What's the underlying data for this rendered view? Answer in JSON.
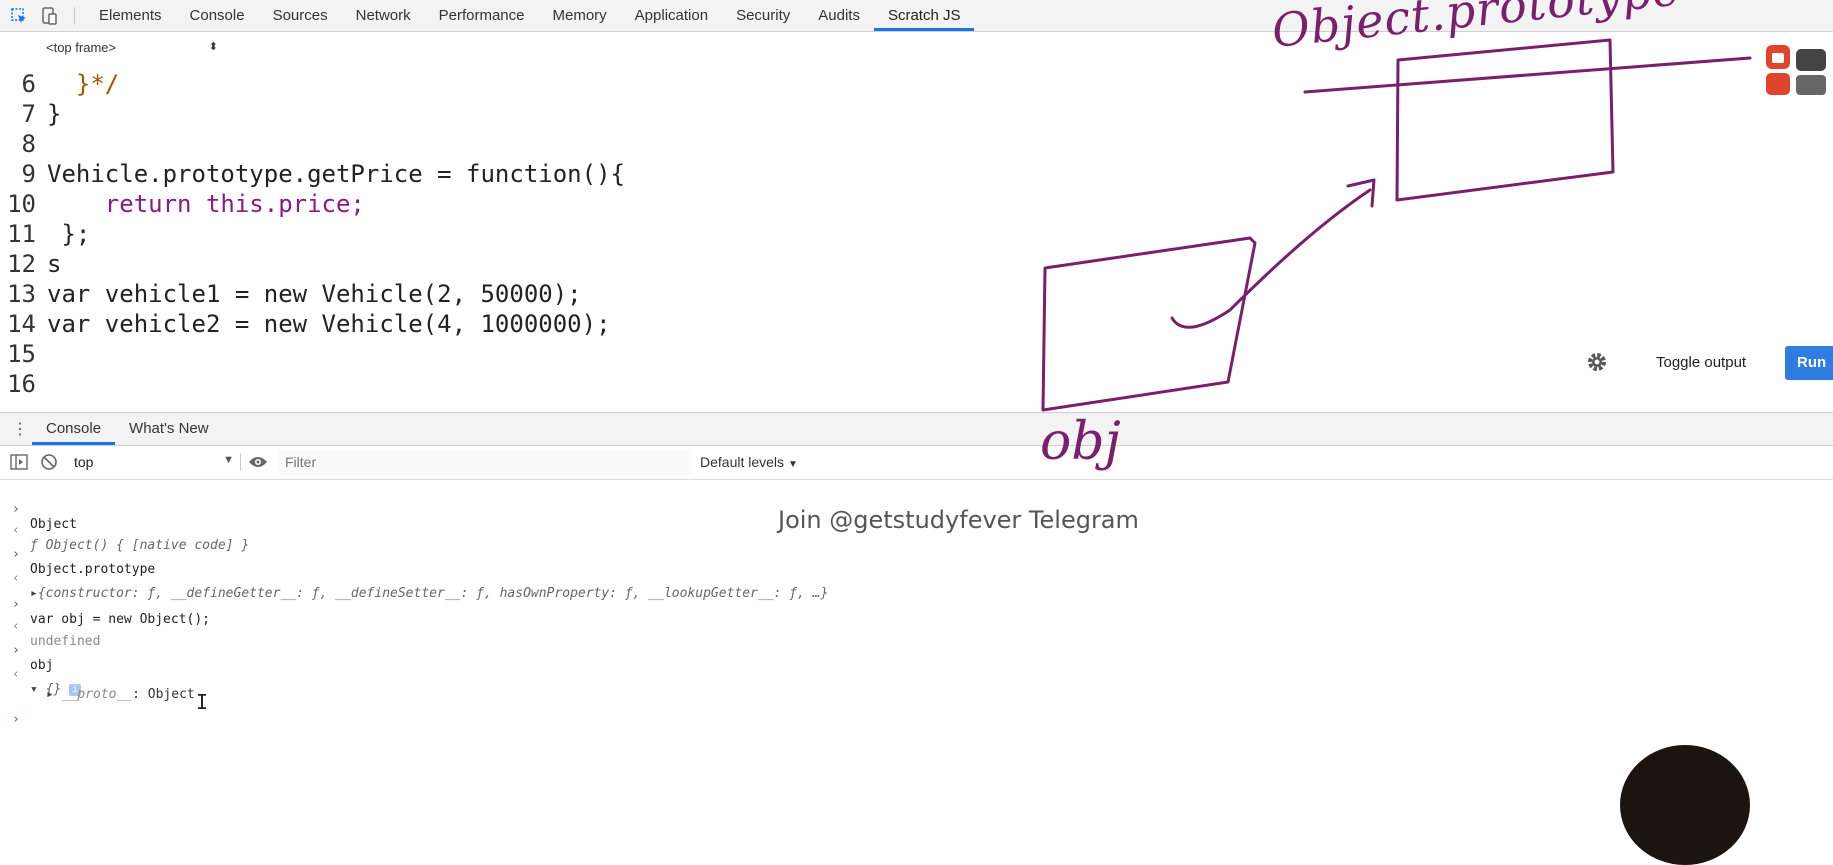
{
  "devtools": {
    "tabs": [
      "Elements",
      "Console",
      "Sources",
      "Network",
      "Performance",
      "Memory",
      "Application",
      "Security",
      "Audits",
      "Scratch JS"
    ],
    "active_tab": "Scratch JS"
  },
  "frame_selector": {
    "value": "<top frame>"
  },
  "editor": {
    "lines": [
      {
        "n": "6",
        "code": "  }*/"
      },
      {
        "n": "7",
        "code": "}"
      },
      {
        "n": "8",
        "code": ""
      },
      {
        "n": "9",
        "code": "Vehicle.prototype.getPrice = function(){"
      },
      {
        "n": "10",
        "code": "    return this.price;"
      },
      {
        "n": "11",
        "code": " };"
      },
      {
        "n": "12",
        "code": "s"
      },
      {
        "n": "13",
        "code": "var vehicle1 = new Vehicle(2, 50000);"
      },
      {
        "n": "14",
        "code": "var vehicle2 = new Vehicle(4, 1000000);"
      },
      {
        "n": "15",
        "code": ""
      },
      {
        "n": "16",
        "code": ""
      }
    ],
    "toggle_output_label": "Toggle output",
    "run_label": "Run"
  },
  "drawer": {
    "tabs": [
      "Console",
      "What's New"
    ],
    "active_tab": "Console"
  },
  "console_toolbar": {
    "context": "top",
    "filter_placeholder": "Filter",
    "levels": "Default levels"
  },
  "console": {
    "entries": [
      {
        "type": "input",
        "text": "Object"
      },
      {
        "type": "result",
        "text": "ƒ Object() { [native code] }"
      },
      {
        "type": "input",
        "text": "Object.prototype"
      },
      {
        "type": "result-obj",
        "text": "{constructor: ƒ, __defineGetter__: ƒ, __defineSetter__: ƒ, hasOwnProperty: ƒ, __lookupGetter__: ƒ, …}"
      },
      {
        "type": "input",
        "text": "var obj = new Object();"
      },
      {
        "type": "result",
        "text": "undefined"
      },
      {
        "type": "input",
        "text": "obj"
      },
      {
        "type": "result-expanded",
        "text": "{}",
        "info": "i"
      },
      {
        "type": "child",
        "key": "__proto__",
        "value": ": Object"
      },
      {
        "type": "prompt",
        "text": ""
      }
    ]
  },
  "watermark": "Join @getstudyfever Telegram",
  "annotations": {
    "top_label": "Object.prototype",
    "bottom_label": "obj",
    "ink_color": "#7a1f6e"
  }
}
